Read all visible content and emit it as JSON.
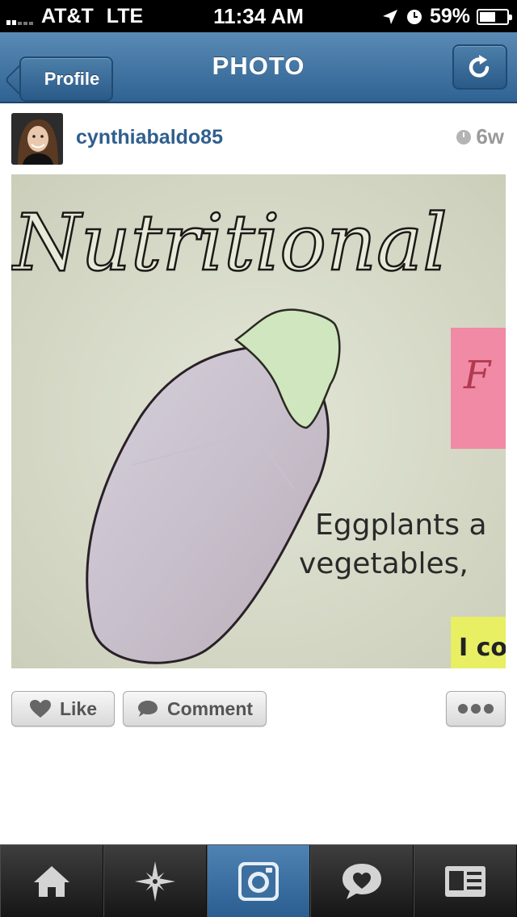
{
  "status_bar": {
    "carrier": "AT&T",
    "network": "LTE",
    "time": "11:34 AM",
    "battery": "59%",
    "battery_level": 0.59
  },
  "nav": {
    "back_label": "Profile",
    "title": "PHOTO",
    "refresh_icon": "refresh-icon"
  },
  "post": {
    "username": "cynthiabaldo85",
    "time_ago": "6w",
    "photo": {
      "title_text": "Nutritional",
      "sticky_note_letter": "F",
      "caption_line1": "Eggplants a",
      "caption_line2": "vegetables,",
      "yellow_note_text": "I co"
    }
  },
  "actions": {
    "like_label": "Like",
    "comment_label": "Comment",
    "more_icon": "more-icon"
  },
  "tab_bar": {
    "items": [
      {
        "icon": "home-icon"
      },
      {
        "icon": "explore-icon"
      },
      {
        "icon": "camera-icon"
      },
      {
        "icon": "activity-icon"
      },
      {
        "icon": "profile-icon"
      }
    ],
    "active_index": 2
  },
  "colors": {
    "nav_blue": "#2f6393",
    "username_blue": "#2f5f8e",
    "tab_active": "#3d72a4"
  }
}
